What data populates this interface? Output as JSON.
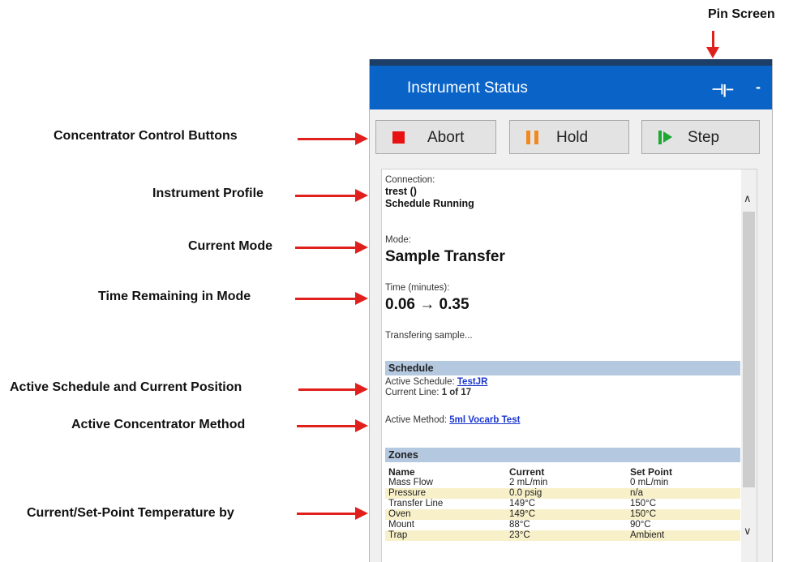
{
  "callouts": {
    "pin_screen": "Pin Screen",
    "control_buttons": "Concentrator Control Buttons",
    "instrument_profile": "Instrument Profile",
    "current_mode": "Current Mode",
    "time_remaining": "Time Remaining in Mode",
    "active_schedule": "Active Schedule and Current Position",
    "active_method": "Active Concentrator Method",
    "temperature": "Current/Set-Point Temperature by"
  },
  "window": {
    "title": "Instrument Status",
    "pin_icon": "pin-icon",
    "pin_glyph": "⊣|−",
    "minimize_glyph": "-"
  },
  "buttons": {
    "abort": "Abort",
    "hold": "Hold",
    "step": "Step"
  },
  "status": {
    "connection_label": "Connection:",
    "connection_value": "trest ()",
    "schedule_state": "Schedule Running",
    "mode_label": "Mode:",
    "mode_value": "Sample Transfer",
    "time_label": "Time (minutes):",
    "time_value": "0.06 → 0.35",
    "message": "Transfering sample..."
  },
  "schedule": {
    "header": "Schedule",
    "active_label": "Active Schedule:",
    "active_value": "TestJR",
    "line_label": "Current Line:",
    "line_value": "1 of 17",
    "method_label": "Active Method:",
    "method_value": "5ml Vocarb Test"
  },
  "zones": {
    "header": "Zones",
    "columns": [
      "Name",
      "Current",
      "Set Point"
    ],
    "rows": [
      [
        "Mass Flow",
        "2 mL/min",
        "0 mL/min"
      ],
      [
        "Pressure",
        "0.0 psig",
        "n/a"
      ],
      [
        "Transfer Line",
        "149°C",
        "150°C"
      ],
      [
        "Oven",
        "149°C",
        "150°C"
      ],
      [
        "Mount",
        "88°C",
        "90°C"
      ],
      [
        "Trap",
        "23°C",
        "Ambient"
      ]
    ]
  },
  "scrollbar": {
    "up_glyph": "∧",
    "down_glyph": "∨"
  },
  "colors": {
    "titlebar": "#0a64c8",
    "arrow": "#e0201c",
    "section_header": "#b4c8e0",
    "zone_row_alt": "#f7f0c8"
  }
}
